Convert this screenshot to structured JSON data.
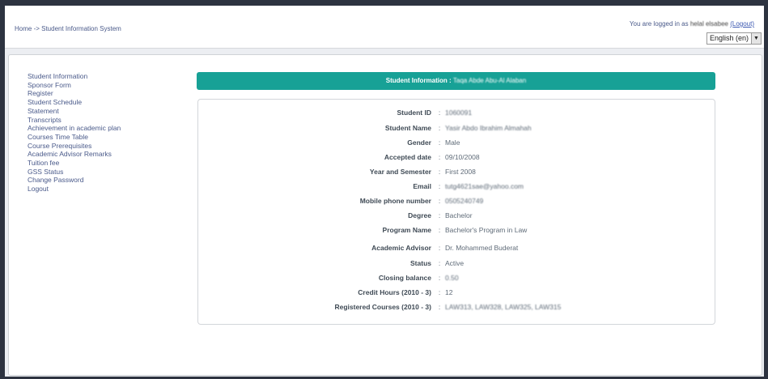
{
  "header": {
    "breadcrumb": "Home -> Student Information System",
    "login_prefix": "You are logged in as",
    "login_user": "helal elsabee",
    "logout_label": "(Logout)",
    "language": "English (en)"
  },
  "sidebar": {
    "items": [
      {
        "label": "Student Information"
      },
      {
        "label": "Sponsor Form"
      },
      {
        "label": "Register"
      },
      {
        "label": "Student Schedule"
      },
      {
        "label": "Statement"
      },
      {
        "label": "Transcripts"
      },
      {
        "label": "Achievement in academic plan"
      },
      {
        "label": "Courses Time Table"
      },
      {
        "label": "Course Prerequisites"
      },
      {
        "label": "Academic Advisor Remarks"
      },
      {
        "label": "Tuition fee"
      },
      {
        "label": "GSS Status"
      },
      {
        "label": "Change Password"
      },
      {
        "label": "Logout"
      }
    ]
  },
  "banner": {
    "prefix": "Student Information :",
    "name": "Taqa Abde Abu-Al Alaban"
  },
  "student": {
    "separator": ":",
    "fields": [
      {
        "label": "Student ID",
        "value": "1060091"
      },
      {
        "label": "Student Name",
        "value": "Yasir Abdo Ibrahim Almahah"
      },
      {
        "label": "Gender",
        "value": "Male"
      },
      {
        "label": "Accepted date",
        "value": "09/10/2008"
      },
      {
        "label": "Year and Semester",
        "value": "First 2008"
      },
      {
        "label": "Email",
        "value": "tutg4621sae@yahoo.com"
      },
      {
        "label": "Mobile phone number",
        "value": "0505240749"
      },
      {
        "label": "Degree",
        "value": "Bachelor"
      },
      {
        "label": "Program Name",
        "value": "Bachelor's Program in Law"
      },
      {
        "label": "Academic Advisor",
        "value": "Dr. Mohammed Buderat"
      },
      {
        "label": "Status",
        "value": "Active"
      },
      {
        "label": "Closing balance",
        "value": "0.50"
      },
      {
        "label": "Credit Hours (2010 - 3)",
        "value": "12"
      },
      {
        "label": "Registered Courses (2010 - 3)",
        "value": "LAW313, LAW328, LAW325, LAW315"
      }
    ]
  }
}
